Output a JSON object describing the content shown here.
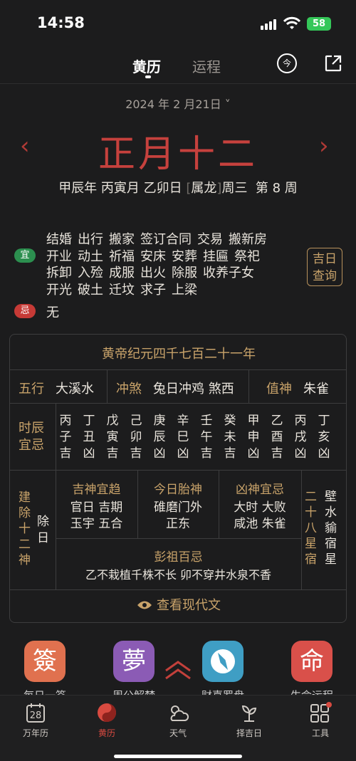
{
  "status": {
    "time": "14:58",
    "battery": "58"
  },
  "header": {
    "tab_active": "黄历",
    "tab_inactive": "运程",
    "circle_icon": "今"
  },
  "date": {
    "solar": "2024 年 2 月21日",
    "lunar": "正月十二",
    "ganzhi": [
      "甲辰年",
      "丙寅月",
      "乙卯日",
      "属龙",
      "周三",
      "第 8 周"
    ]
  },
  "yi": {
    "label": "宜",
    "lines": [
      [
        "结婚",
        "出行",
        "搬家",
        "签订合同",
        "交易",
        "搬新房"
      ],
      [
        "开业",
        "动土",
        "祈福",
        "安床",
        "安葬",
        "挂匾",
        "祭祀"
      ],
      [
        "拆卸",
        "入殓",
        "成服",
        "出火",
        "除服",
        "收养子女"
      ],
      [
        "开光",
        "破土",
        "迁坟",
        "求子",
        "上梁"
      ]
    ]
  },
  "ji": {
    "label": "忌",
    "text": "无"
  },
  "jiri_button": [
    "吉日",
    "查询"
  ],
  "table": {
    "era": "黄帝纪元四千七百二十一年",
    "wuxing_label": "五行",
    "wuxing": "大溪水",
    "chongsha_label": "冲煞",
    "chongsha": "兔日冲鸡 煞西",
    "zhishen_label": "值神",
    "zhishen": "朱雀",
    "shichen_label": [
      "时辰",
      "宜忌"
    ],
    "shichen": [
      [
        "丙",
        "子",
        "吉"
      ],
      [
        "丁",
        "丑",
        "凶"
      ],
      [
        "戊",
        "寅",
        "吉"
      ],
      [
        "己",
        "卯",
        "吉"
      ],
      [
        "庚",
        "辰",
        "凶"
      ],
      [
        "辛",
        "巳",
        "凶"
      ],
      [
        "壬",
        "午",
        "吉"
      ],
      [
        "癸",
        "未",
        "吉"
      ],
      [
        "甲",
        "申",
        "凶"
      ],
      [
        "乙",
        "酉",
        "吉"
      ],
      [
        "丙",
        "戌",
        "凶"
      ],
      [
        "丁",
        "亥",
        "凶"
      ]
    ],
    "jianchu_label": [
      "建",
      "除",
      "十",
      "二",
      "神"
    ],
    "jianchu": [
      "除",
      "日"
    ],
    "jishen_label": "吉神宜趋",
    "jishen": [
      "官日 吉期",
      "玉宇 五合"
    ],
    "taishen_label": "今日胎神",
    "taishen": [
      "碓磨门外",
      "正东"
    ],
    "xiongshen_label": "凶神宜忌",
    "xiongshen": [
      "大时 大败",
      "咸池 朱雀"
    ],
    "xiu_label": [
      "二",
      "十",
      "八",
      "星",
      "宿"
    ],
    "xiu": [
      "壁",
      "水",
      "貐",
      "宿",
      "星"
    ],
    "pengzu_label": "彭祖百忌",
    "pengzu": "乙不栽植千株不长 卯不穿井水泉不香",
    "modern_link": "查看现代文"
  },
  "apps": [
    {
      "char": "簽",
      "label": "每日一签",
      "color": "#e0714f"
    },
    {
      "char": "夢",
      "label": "周公解梦",
      "color": "#8b5bb5"
    },
    {
      "char": "☉",
      "label": "财喜罗盘",
      "color": "#3f9ec4"
    },
    {
      "char": "命",
      "label": "生命运程",
      "color": "#d9504a"
    }
  ],
  "tabbar": [
    {
      "label": "万年历",
      "icon": "calendar-icon",
      "day": "28"
    },
    {
      "label": "黄历",
      "icon": "yinyang-icon"
    },
    {
      "label": "天气",
      "icon": "weather-icon"
    },
    {
      "label": "择吉日",
      "icon": "sprout-icon"
    },
    {
      "label": "工具",
      "icon": "grid-icon"
    }
  ]
}
